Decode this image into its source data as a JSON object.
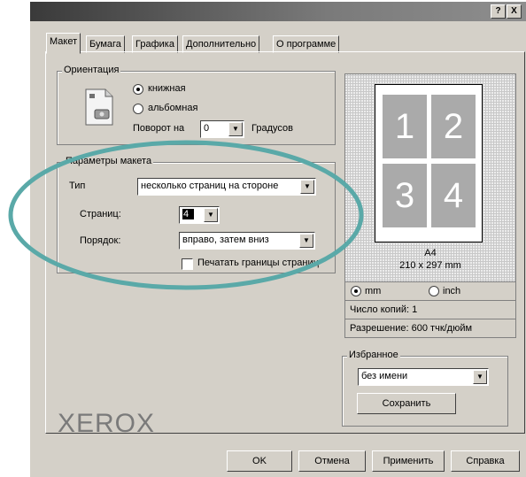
{
  "window": {
    "help_button": "?",
    "close_button": "X"
  },
  "tabs": [
    {
      "label": "Макет",
      "active": true
    },
    {
      "label": "Бумага"
    },
    {
      "label": "Графика"
    },
    {
      "label": "Дополнительно"
    },
    {
      "label": "О программе"
    }
  ],
  "orientation": {
    "title": "Ориентация",
    "options": [
      "книжная",
      "альбомная"
    ],
    "selected": "книжная",
    "rotate_label": "Поворот на",
    "rotate_value": "0",
    "rotate_unit": "Градусов"
  },
  "layout_options": {
    "title": "Параметры макета",
    "type_label": "Тип",
    "type_value": "несколько страниц на стороне",
    "pages_label": "Страниц:",
    "pages_value": "4",
    "order_label": "Порядок:",
    "order_value": "вправо, затем вниз",
    "print_borders_label": "Печатать границы страниц",
    "print_borders_checked": false
  },
  "preview": {
    "cells": [
      "1",
      "2",
      "3",
      "4"
    ],
    "paper_name": "A4",
    "paper_size": "210 x 297 mm"
  },
  "units": {
    "options": [
      "mm",
      "inch"
    ],
    "selected": "mm"
  },
  "copies": "Число копий: 1",
  "resolution": "Разрешение: 600 тчк/дюйм",
  "favorites": {
    "title": "Избранное",
    "value": "без имени",
    "save_button": "Сохранить"
  },
  "brand": "XEROX",
  "buttons": {
    "ok": "OK",
    "cancel": "Отмена",
    "apply": "Применить",
    "help": "Справка"
  },
  "colors": {
    "highlight_ellipse": "#5aa9a8",
    "cell_fill": "#aaaaaa",
    "dialog_bg": "#d4d0c8"
  }
}
